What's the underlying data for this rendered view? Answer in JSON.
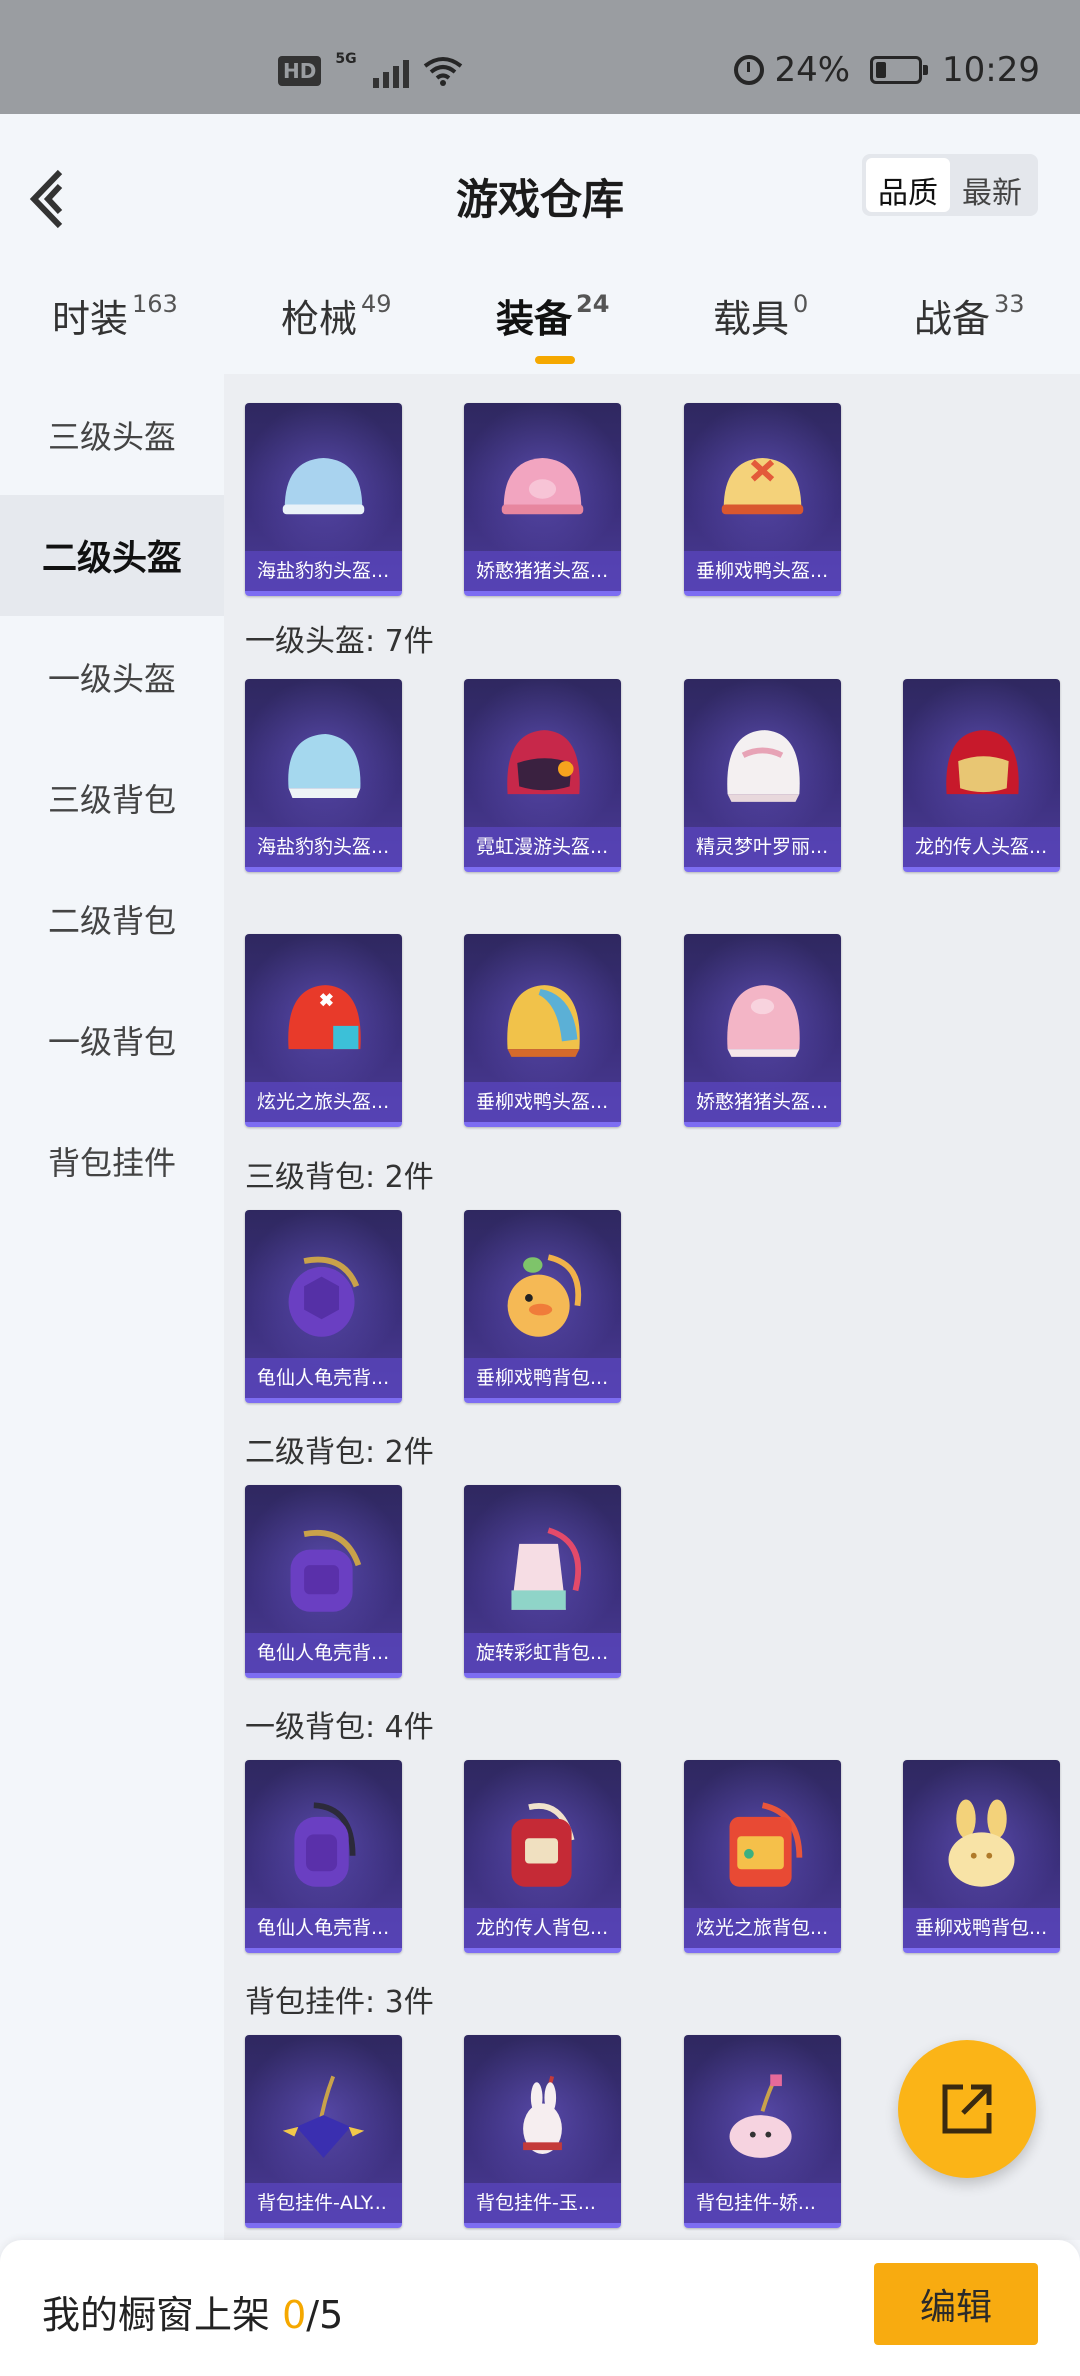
{
  "status_bar": {
    "hd": "HD",
    "network": "5G",
    "battery": "24%",
    "time": "10:29"
  },
  "header": {
    "title": "游戏仓库",
    "sort_options": [
      "品质",
      "最新"
    ]
  },
  "tabs": [
    {
      "label": "时装",
      "count": "163"
    },
    {
      "label": "枪械",
      "count": "49"
    },
    {
      "label": "装备",
      "count": "24",
      "active": true
    },
    {
      "label": "载具",
      "count": "0"
    },
    {
      "label": "战备",
      "count": "33"
    }
  ],
  "sidebar": {
    "items": [
      "三级头盔",
      "二级头盔",
      "一级头盔",
      "三级背包",
      "二级背包",
      "一级背包",
      "背包挂件"
    ],
    "active_index": 1
  },
  "sections": [
    {
      "label": "",
      "items": [
        "海盐豹豹头盔...",
        "娇憨猪猪头盔...",
        "垂柳戏鸭头盔..."
      ]
    },
    {
      "label": "一级头盔: 7件",
      "items": [
        "海盐豹豹头盔...",
        "霓虹漫游头盔...",
        "精灵梦叶罗丽...",
        "龙的传人头盔...",
        "炫光之旅头盔...",
        "垂柳戏鸭头盔...",
        "娇憨猪猪头盔..."
      ]
    },
    {
      "label": "三级背包: 2件",
      "items": [
        "龟仙人龟壳背...",
        "垂柳戏鸭背包..."
      ]
    },
    {
      "label": "二级背包: 2件",
      "items": [
        "龟仙人龟壳背...",
        "旋转彩虹背包..."
      ]
    },
    {
      "label": "一级背包: 4件",
      "items": [
        "龟仙人龟壳背...",
        "龙的传人背包...",
        "炫光之旅背包...",
        "垂柳戏鸭背包..."
      ]
    },
    {
      "label": "背包挂件: 3件",
      "items": [
        "背包挂件-ALY...",
        "背包挂件-玉...",
        "背包挂件-娇..."
      ]
    }
  ],
  "bottom_bar": {
    "text_prefix": "我的橱窗上架 ",
    "count": "0",
    "text_suffix": "/5",
    "edit_label": "编辑"
  },
  "colors": {
    "accent": "#f8ab10",
    "card_bg": "#3b2f7c"
  }
}
